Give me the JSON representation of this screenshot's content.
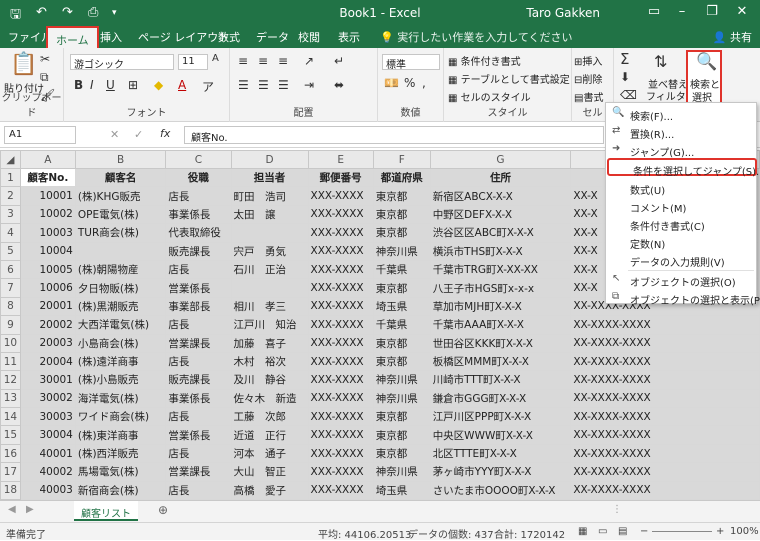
{
  "titlebar": {
    "title": "Book1 - Excel",
    "user": "Taro Gakken"
  },
  "tabs": [
    "ファイル",
    "ホーム",
    "挿入",
    "ページ レイアウト",
    "数式",
    "データ",
    "校閲",
    "表示"
  ],
  "tell_me": "実行したい作業を入力してください",
  "share": "共有",
  "ribbon": {
    "clipboard": {
      "paste": "貼り付け",
      "label": "クリップボード"
    },
    "font": {
      "name": "游ゴシック",
      "size": "11",
      "label": "フォント"
    },
    "alignment": {
      "label": "配置"
    },
    "number": {
      "format": "標準",
      "label": "数値"
    },
    "styles": {
      "conditional": "条件付き書式",
      "table": "テーブルとして書式設定",
      "cell": "セルのスタイル",
      "label": "スタイル"
    },
    "cells": {
      "insert": "挿入",
      "delete": "削除",
      "format": "書式",
      "label": "セル"
    },
    "editing": {
      "sort": "並べ替えと",
      "sort2": "フィルター",
      "find": "検索と",
      "find2": "選択"
    }
  },
  "formula_bar": {
    "name_box": "A1",
    "content": "顧客No."
  },
  "columns": [
    "A",
    "B",
    "C",
    "D",
    "E",
    "F",
    "G"
  ],
  "rows": [
    [
      "顧客No.",
      "顧客名",
      "役職",
      "担当者",
      "郵便番号",
      "都道府県",
      "住所",
      ""
    ],
    [
      "10001",
      "(株)KHG販売",
      "店長",
      "町田　浩司",
      "XXX-XXXX",
      "東京都",
      "新宿区ABCX-X-X",
      "XX-X"
    ],
    [
      "10002",
      "OPE電気(株)",
      "事業係長",
      "太田　譲",
      "XXX-XXXX",
      "東京都",
      "中野区DEFX-X-X",
      "XX-X"
    ],
    [
      "10003",
      "TUR商会(株)",
      "代表取締役",
      "",
      "XXX-XXXX",
      "東京都",
      "渋谷区区ABC町X-X-X",
      "XX-X"
    ],
    [
      "10004",
      "",
      "販売課長",
      "宍戸　勇気",
      "XXX-XXXX",
      "神奈川県",
      "横浜市THS町X-X-X",
      "XX-X"
    ],
    [
      "10005",
      "(株)朝陽物産",
      "店長",
      "石川　正治",
      "XXX-XXXX",
      "千葉県",
      "千葉市TRG町X-XX-XX",
      "XX-X"
    ],
    [
      "10006",
      "夕日物販(株)",
      "営業係長",
      "",
      "XXX-XXXX",
      "東京都",
      "八王子市HGS町x-x-x",
      "XX-X"
    ],
    [
      "20001",
      "(株)黒潮販売",
      "事業部長",
      "相川　孝三",
      "XXX-XXXX",
      "埼玉県",
      "草加市MJH町X-X-X",
      "XX-XXXX-XXXX"
    ],
    [
      "20002",
      "大西洋電気(株)",
      "店長",
      "江戸川　知治",
      "XXX-XXXX",
      "千葉県",
      "千葉市AAA町X-X-X",
      "XX-XXXX-XXXX"
    ],
    [
      "20003",
      "小島商会(株)",
      "営業課長",
      "加藤　喜子",
      "XXX-XXXX",
      "東京都",
      "世田谷区KKK町X-X-X",
      "XX-XXXX-XXXX"
    ],
    [
      "20004",
      "(株)遠洋商事",
      "店長",
      "木村　裕次",
      "XXX-XXXX",
      "東京都",
      "板橋区MMM町X-X-X",
      "XX-XXXX-XXXX"
    ],
    [
      "30001",
      "(株)小島販売",
      "販売課長",
      "及川　静谷",
      "XXX-XXXX",
      "神奈川県",
      "川崎市TTT町X-X-X",
      "XX-XXXX-XXXX"
    ],
    [
      "30002",
      "海洋電気(株)",
      "事業係長",
      "佐々木　新造",
      "XXX-XXXX",
      "神奈川県",
      "鎌倉市GGG町X-X-X",
      "XX-XXXX-XXXX"
    ],
    [
      "30003",
      "ワイド商会(株)",
      "店長",
      "工藤　次郎",
      "XXX-XXXX",
      "東京都",
      "江戸川区PPP町X-X-X",
      "XX-XXXX-XXXX"
    ],
    [
      "30004",
      "(株)東洋商事",
      "営業係長",
      "近道　正行",
      "XXX-XXXX",
      "東京都",
      "中央区WWW町X-X-X",
      "XX-XXXX-XXXX"
    ],
    [
      "40001",
      "(株)西洋販売",
      "店長",
      "河本　通子",
      "XXX-XXXX",
      "東京都",
      "北区TTTE町X-X-X",
      "XX-XXXX-XXXX"
    ],
    [
      "40002",
      "馬場電気(株)",
      "営業課長",
      "大山　智正",
      "XXX-XXXX",
      "神奈川県",
      "茅ヶ崎市YYY町X-X-X",
      "XX-XXXX-XXXX"
    ],
    [
      "40003",
      "新宿商会(株)",
      "店長",
      "高橋　愛子",
      "XXX-XXXX",
      "埼玉県",
      "さいたま市OOOO町X-X-X",
      "XX-XXXX-XXXX"
    ]
  ],
  "sheet_tab": "顧客リスト",
  "status": {
    "ready": "準備完了",
    "average": "平均: 44106.20513",
    "count": "データの個数: 437",
    "sum": "合計: 1720142",
    "zoom": "100%"
  },
  "menu": {
    "items": [
      "検索(F)...",
      "置換(R)...",
      "ジャンプ(G)...",
      "条件を選択してジャンプ(S)...",
      "数式(U)",
      "コメント(M)",
      "条件付き書式(C)",
      "定数(N)",
      "データの入力規則(V)",
      "オブジェクトの選択(O)",
      "オブジェクトの選択と表示(P)..."
    ]
  },
  "colors": {
    "accent": "#217346",
    "highlight": "#e0332b",
    "selection": "#d9d9d9"
  }
}
